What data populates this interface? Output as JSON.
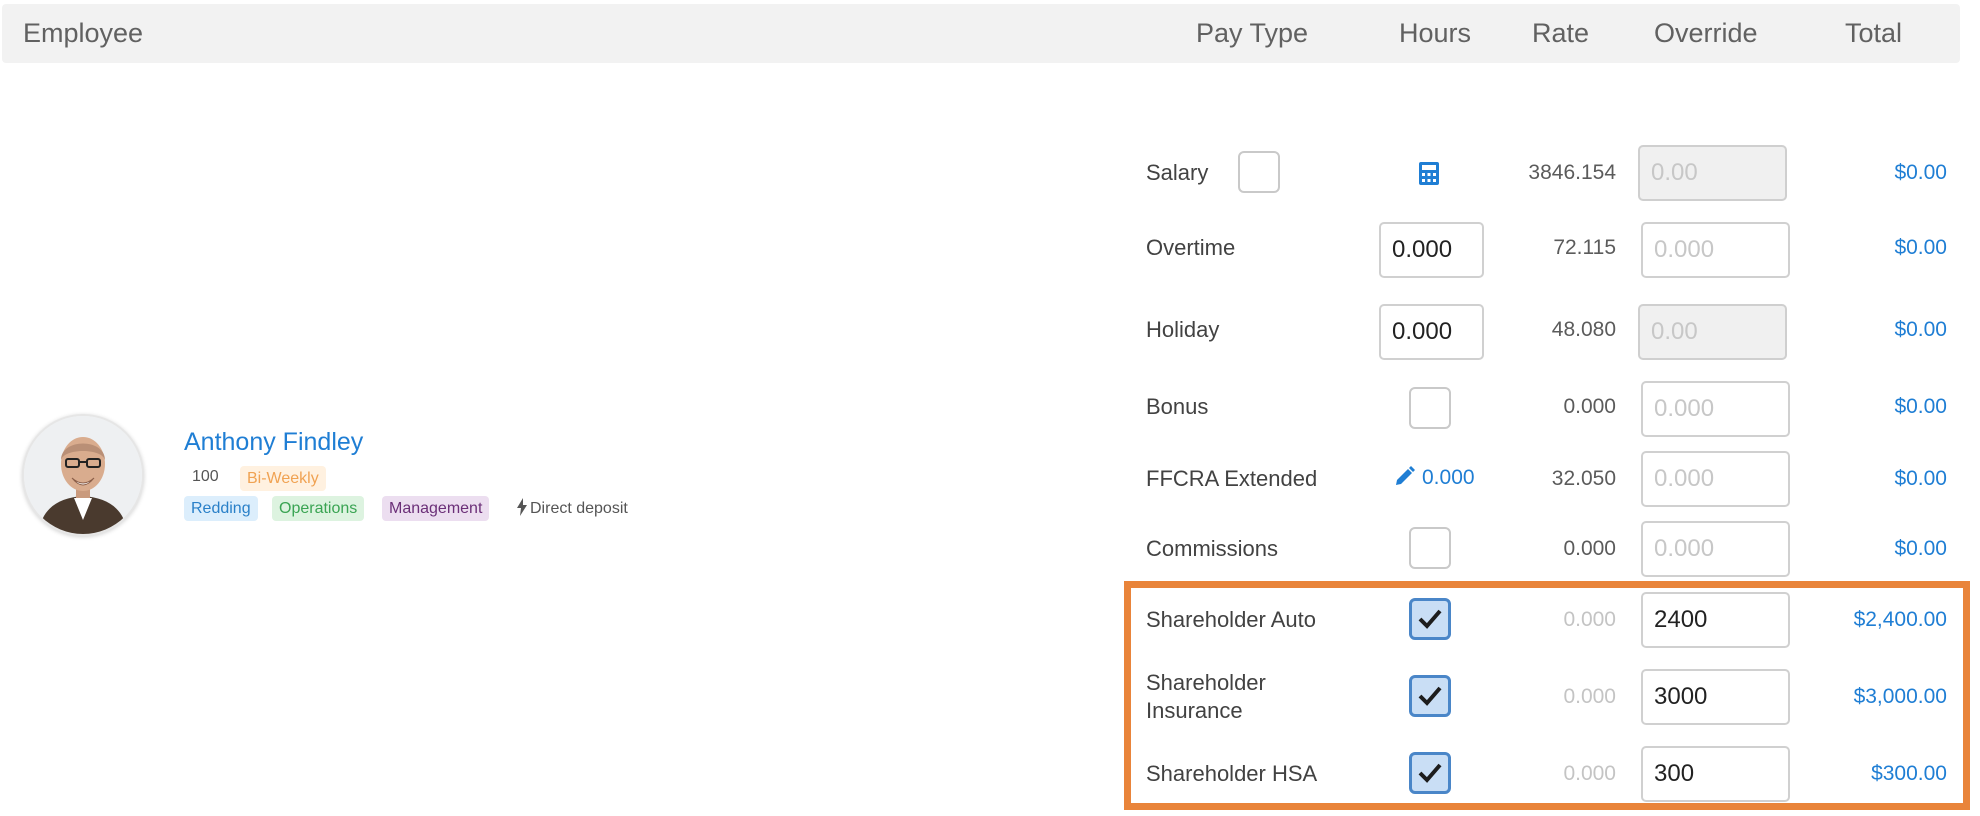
{
  "header": {
    "employee": "Employee",
    "pay_type": "Pay Type",
    "hours": "Hours",
    "rate": "Rate",
    "override": "Override",
    "total": "Total"
  },
  "employee": {
    "name": "Anthony Findley",
    "id": "100",
    "frequency": "Bi-Weekly",
    "location": "Redding",
    "department": "Operations",
    "role": "Management",
    "deposit": "Direct deposit"
  },
  "rows": [
    {
      "label": "Salary",
      "rate": "3846.154",
      "override_placeholder": "0.00",
      "total": "$0.00"
    },
    {
      "label": "Overtime",
      "hours": "0.000",
      "rate": "72.115",
      "override_placeholder": "0.000",
      "total": "$0.00"
    },
    {
      "label": "Holiday",
      "hours": "0.000",
      "rate": "48.080",
      "override_placeholder": "0.00",
      "total": "$0.00"
    },
    {
      "label": "Bonus",
      "rate": "0.000",
      "override_placeholder": "0.000",
      "total": "$0.00"
    },
    {
      "label": "FFCRA Extended",
      "hours_link": "0.000",
      "rate": "32.050",
      "override_placeholder": "0.000",
      "total": "$0.00"
    },
    {
      "label": "Commissions",
      "rate": "0.000",
      "override_placeholder": "0.000",
      "total": "$0.00"
    },
    {
      "label": "Shareholder Auto",
      "rate": "0.000",
      "override": "2400",
      "total": "$2,400.00"
    },
    {
      "label": "Shareholder Insurance",
      "rate": "0.000",
      "override": "3000",
      "total": "$3,000.00"
    },
    {
      "label": "Shareholder HSA",
      "rate": "0.000",
      "override": "300",
      "total": "$300.00"
    }
  ],
  "colors": {
    "accent": "#1f7ed4",
    "highlight": "#e9843a"
  }
}
